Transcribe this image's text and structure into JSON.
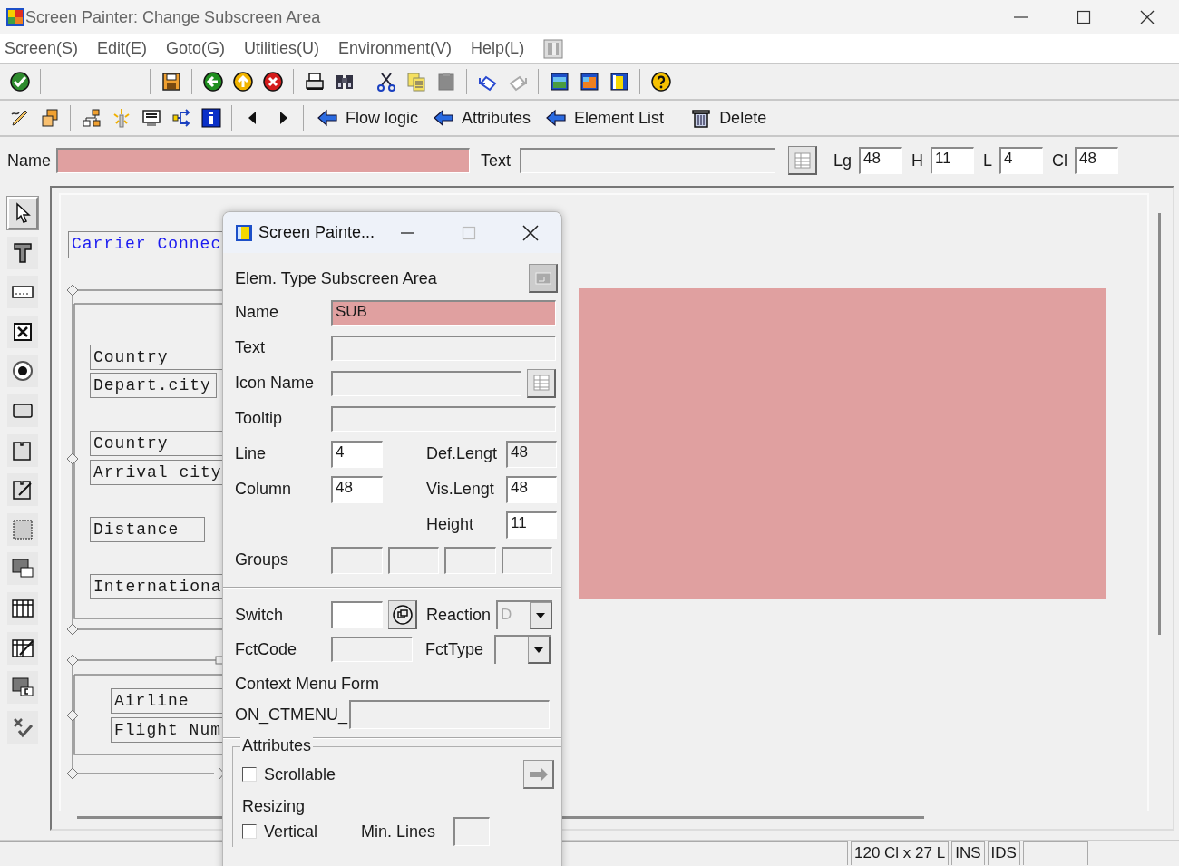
{
  "window": {
    "title": "Screen Painter: Change Subscreen Area"
  },
  "menu": [
    {
      "label": "Screen(S)"
    },
    {
      "label": "Edit(E)"
    },
    {
      "label": "Goto(G)"
    },
    {
      "label": "Utilities(U)"
    },
    {
      "label": "Environment(V)"
    },
    {
      "label": "Help(L)"
    }
  ],
  "toolbar_buttons": [
    {
      "label": "Flow logic",
      "kind": "arrow"
    },
    {
      "label": "Attributes",
      "kind": "arrow"
    },
    {
      "label": "Element List",
      "kind": "arrow"
    },
    {
      "label": "Delete",
      "kind": "trash"
    }
  ],
  "element_bar": {
    "name_label": "Name",
    "text_label": "Text",
    "metrics": [
      {
        "label": "Lg",
        "value": "48"
      },
      {
        "label": "H",
        "value": "11"
      },
      {
        "label": "L",
        "value": "4"
      },
      {
        "label": "Cl",
        "value": "48"
      }
    ]
  },
  "palette": [
    {
      "selected": true
    },
    {
      "selected": false
    },
    {
      "selected": false
    },
    {
      "selected": false
    },
    {
      "selected": false
    },
    {
      "selected": false
    },
    {
      "selected": false
    },
    {
      "selected": false
    },
    {
      "selected": false
    },
    {
      "selected": false
    },
    {
      "selected": false
    },
    {
      "selected": false
    },
    {
      "selected": false
    },
    {
      "selected": false
    }
  ],
  "canvas": {
    "elements": [
      {
        "kind": "title",
        "text": "Carrier Connec"
      },
      {
        "kind": "label",
        "text": "Country"
      },
      {
        "kind": "label",
        "text": "Depart.city"
      },
      {
        "kind": "label",
        "text": "Country"
      },
      {
        "kind": "label",
        "text": "Arrival city"
      },
      {
        "kind": "label",
        "text": "Distance"
      },
      {
        "kind": "label",
        "text": "Internationa"
      },
      {
        "kind": "label",
        "text": "Airline"
      },
      {
        "kind": "label",
        "text": "Flight Num"
      }
    ]
  },
  "dialog": {
    "title": "Screen Painte...",
    "elem_type_label": "Elem. Type",
    "elem_type": "Subscreen Area",
    "name": {
      "label": "Name",
      "value": "SUB"
    },
    "text": {
      "label": "Text"
    },
    "icon_name": {
      "label": "Icon Name"
    },
    "tooltip": {
      "label": "Tooltip"
    },
    "line": {
      "label": "Line",
      "value": "4"
    },
    "def_length": {
      "label": "Def.Lengt",
      "value": "48"
    },
    "column": {
      "label": "Column",
      "value": "48"
    },
    "vis_length": {
      "label": "Vis.Lengt",
      "value": "48"
    },
    "height": {
      "label": "Height",
      "value": "11"
    },
    "groups_label": "Groups",
    "switch_label": "Switch",
    "reaction": {
      "label": "Reaction",
      "value": "D",
      "disabled": true
    },
    "fctcode_label": "FctCode",
    "fcttype_label": "FctType",
    "context_menu_label": "Context Menu Form",
    "ctmenu_prefix": "ON_CTMENU_",
    "attributes": {
      "title": "Attributes",
      "scrollable": {
        "label": "Scrollable",
        "checked": false
      },
      "resizing_label": "Resizing",
      "vertical": {
        "label": "Vertical",
        "checked": false
      },
      "min_lines_label": "Min. Lines"
    }
  },
  "status_bar": {
    "cells": [
      "120 Cl x 27 L",
      "INS",
      "IDS"
    ]
  }
}
